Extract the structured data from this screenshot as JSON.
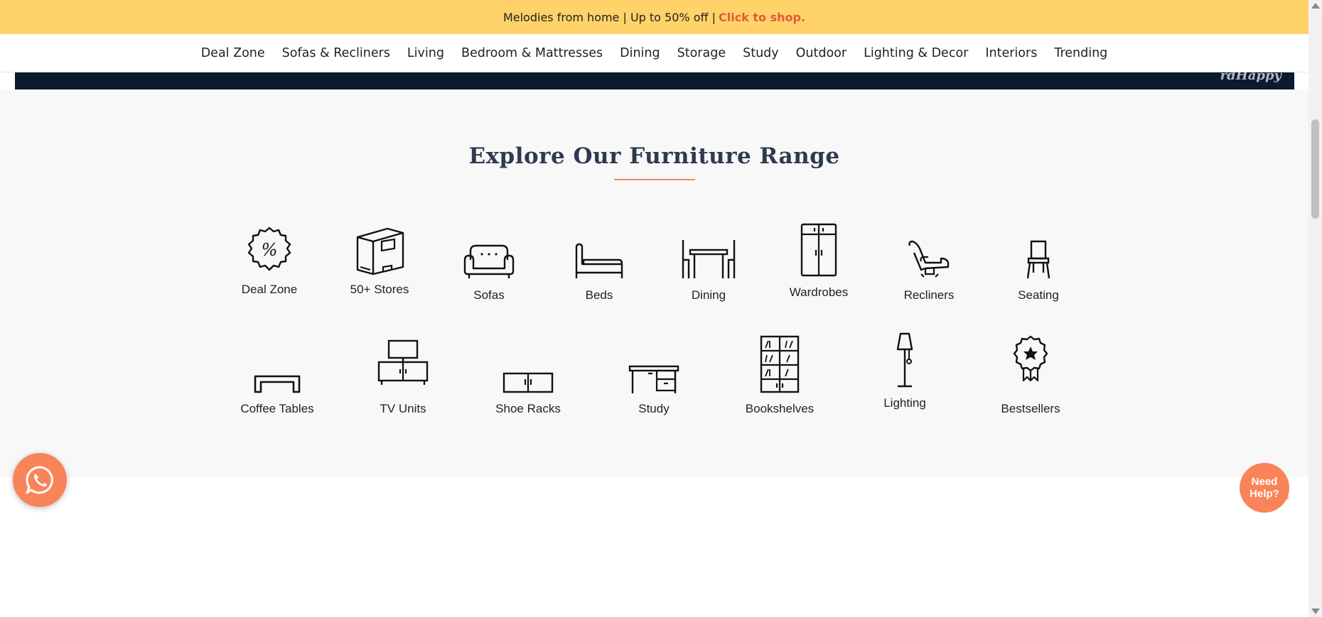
{
  "promo": {
    "text": "Melodies from home | Up to 50% off |",
    "link": "Click to shop."
  },
  "nav": {
    "items": [
      "Deal Zone",
      "Sofas & Recliners",
      "Living",
      "Bedroom & Mattresses",
      "Dining",
      "Storage",
      "Study",
      "Outdoor",
      "Lighting & Decor",
      "Interiors",
      "Trending"
    ]
  },
  "banner": {
    "script_text": "rdHappy"
  },
  "explore": {
    "title": "Explore Our Furniture Range",
    "row1": [
      {
        "label": "Deal Zone",
        "icon": "percent-badge-icon"
      },
      {
        "label": "50+ Stores",
        "icon": "store-icon"
      },
      {
        "label": "Sofas",
        "icon": "sofa-icon"
      },
      {
        "label": "Beds",
        "icon": "bed-icon"
      },
      {
        "label": "Dining",
        "icon": "dining-icon"
      },
      {
        "label": "Wardrobes",
        "icon": "wardrobe-icon"
      },
      {
        "label": "Recliners",
        "icon": "recliner-icon"
      },
      {
        "label": "Seating",
        "icon": "chair-icon"
      }
    ],
    "row2": [
      {
        "label": "Coffee Tables",
        "icon": "coffee-table-icon"
      },
      {
        "label": "TV Units",
        "icon": "tv-unit-icon"
      },
      {
        "label": "Shoe Racks",
        "icon": "shoe-rack-icon"
      },
      {
        "label": "Study",
        "icon": "study-desk-icon"
      },
      {
        "label": "Bookshelves",
        "icon": "bookshelf-icon"
      },
      {
        "label": "Lighting",
        "icon": "lamp-icon"
      },
      {
        "label": "Bestsellers",
        "icon": "bestseller-badge-icon"
      }
    ]
  },
  "help": {
    "line1": "Need",
    "line2": "Help?"
  },
  "colors": {
    "promo_bg": "#ffd26a",
    "accent": "#f9845a",
    "link": "#e05a3a",
    "title": "#2f3a4f"
  }
}
